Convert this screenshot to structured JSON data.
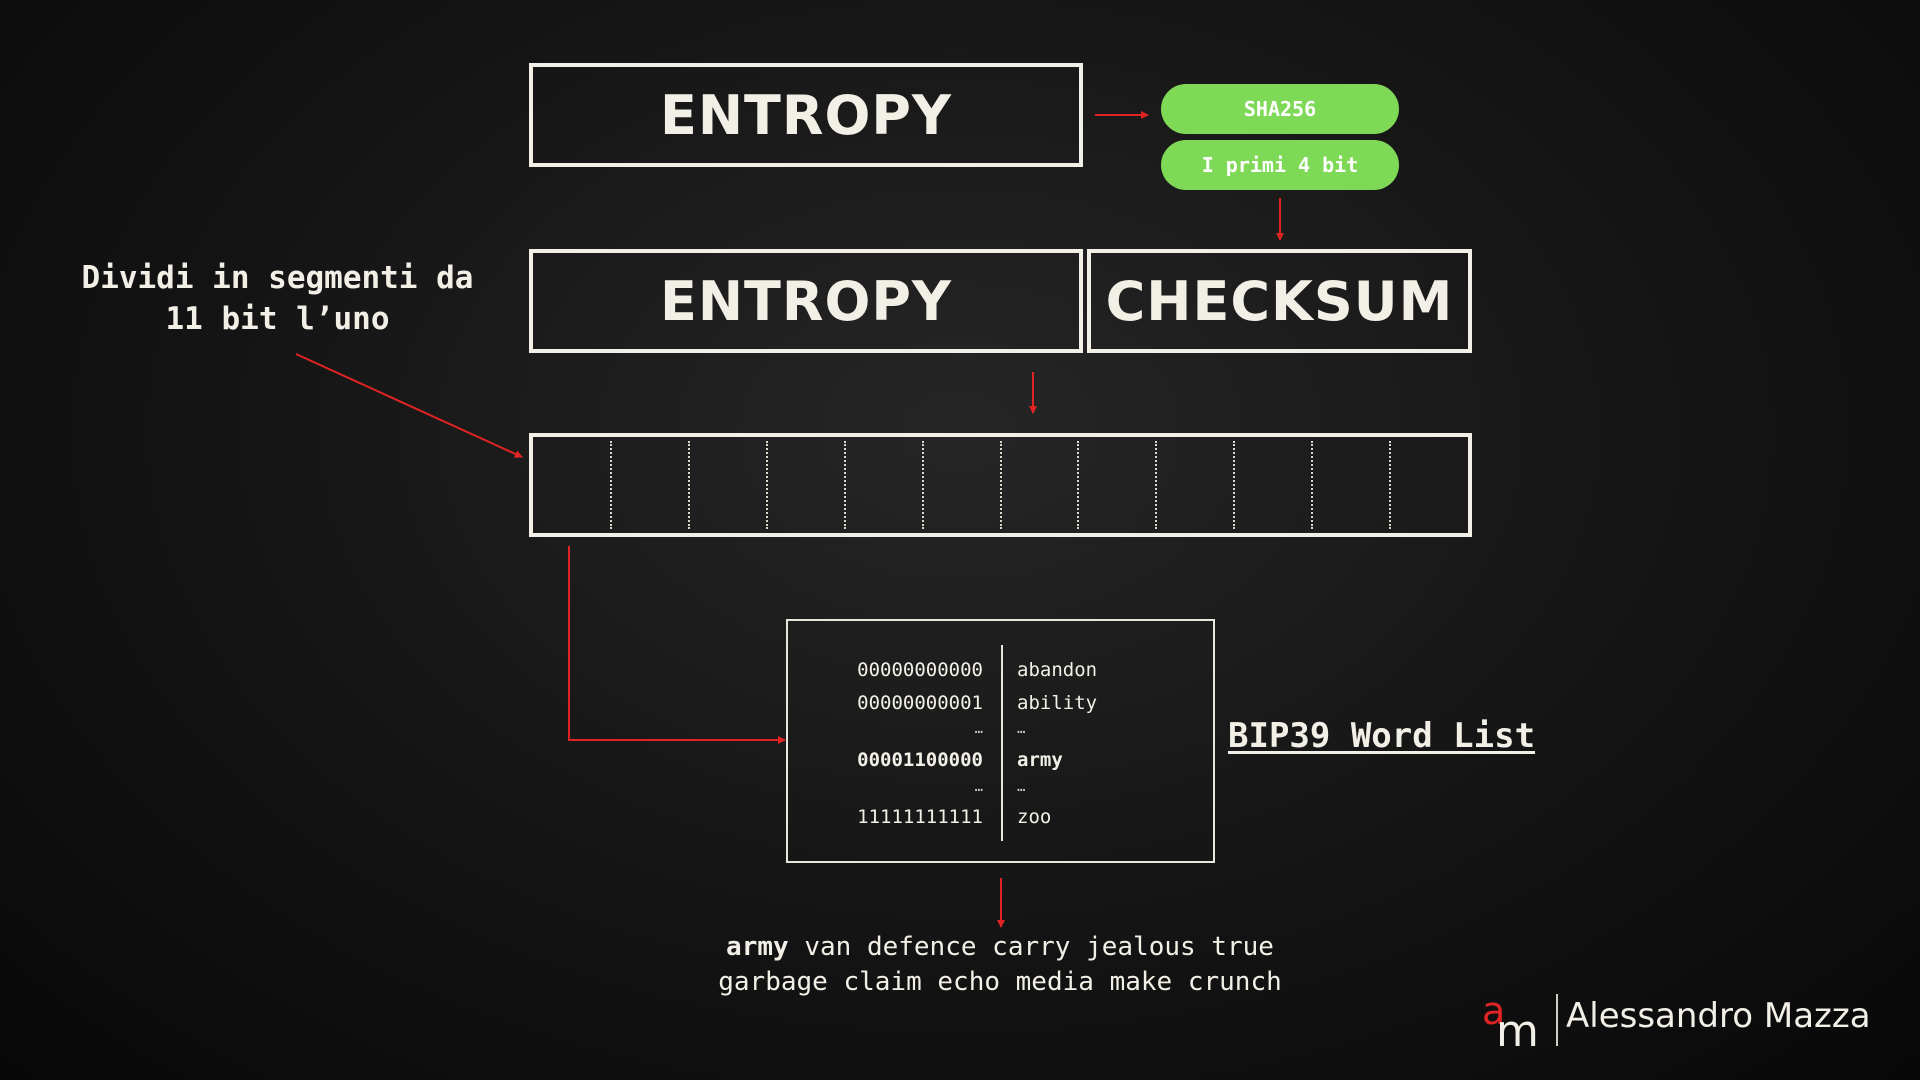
{
  "top_entropy_label": "ENTROPY",
  "pills": {
    "sha_label": "SHA256",
    "bits_label": "I primi 4 bit"
  },
  "row2": {
    "entropy_label": "ENTROPY",
    "checksum_label": "CHECKSUM"
  },
  "left_note": {
    "line1": "Dividi in segmenti da",
    "line2": "11 bit l’uno"
  },
  "segments": {
    "count": 12
  },
  "wordlist": {
    "label": "BIP39 Word List",
    "rows": [
      {
        "bits": "00000000000",
        "word": "abandon",
        "bold": false
      },
      {
        "bits": "00000000001",
        "word": "ability",
        "bold": false
      },
      {
        "bits": "…",
        "word": "…",
        "bold": false,
        "ellipsis": true
      },
      {
        "bits": "00001100000",
        "word": "army",
        "bold": true
      },
      {
        "bits": "…",
        "word": "…",
        "bold": false,
        "ellipsis": true
      },
      {
        "bits": "11111111111",
        "word": "zoo",
        "bold": false
      }
    ]
  },
  "mnemonic": {
    "first_word": "army",
    "line1_rest": " van defence carry jealous true",
    "line2": "garbage claim echo media make crunch"
  },
  "brand": {
    "logo_text": "am",
    "name": "Alessandro Mazza"
  },
  "colors": {
    "arrow": "#e02424",
    "pill": "#7ed957",
    "box_border": "#f2f0e6"
  }
}
